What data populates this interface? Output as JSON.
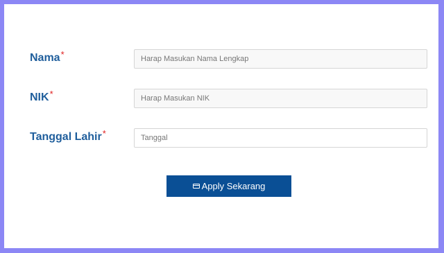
{
  "form": {
    "fields": [
      {
        "label": "Nama",
        "required_mark": "*",
        "placeholder": "Harap Masukan Nama Lengkap",
        "value": ""
      },
      {
        "label": "NIK",
        "required_mark": "*",
        "placeholder": "Harap Masukan NIK",
        "value": ""
      },
      {
        "label": "Tanggal Lahir",
        "required_mark": "*",
        "placeholder": "Tanggal",
        "value": ""
      }
    ],
    "submit_label": "Apply Sekarang",
    "submit_icon": "credit-card-icon"
  },
  "colors": {
    "frame_border": "#8c87f5",
    "label": "#1f5e9c",
    "required": "#e02020",
    "button": "#0a4f95"
  }
}
